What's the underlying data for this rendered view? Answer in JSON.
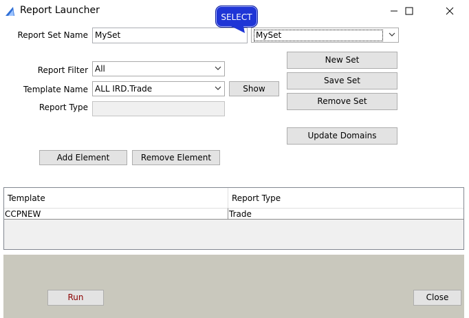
{
  "window": {
    "title": "Report Launcher"
  },
  "tooltip": "SELECT",
  "form": {
    "report_set_label": "Report Set Name",
    "report_set_value": "MySet",
    "report_set_combo": "MySet",
    "report_filter_label": "Report Filter",
    "report_filter_value": "All",
    "template_name_label": "Template Name",
    "template_name_value": "ALL IRD.Trade",
    "report_type_label": "Report Type",
    "report_type_value": ""
  },
  "buttons": {
    "show": "Show",
    "new_set": "New Set",
    "save_set": "Save Set",
    "remove_set": "Remove Set",
    "update_domains": "Update Domains",
    "add_element": "Add Element",
    "remove_element": "Remove Element",
    "run": "Run",
    "close": "Close"
  },
  "table": {
    "headers": [
      "Template",
      "Report Type"
    ],
    "rows": [
      [
        "CCPNEW",
        "Trade"
      ]
    ]
  },
  "colors": {
    "run_text": "#8b0000",
    "tooltip_bg": "#1f35d6"
  }
}
